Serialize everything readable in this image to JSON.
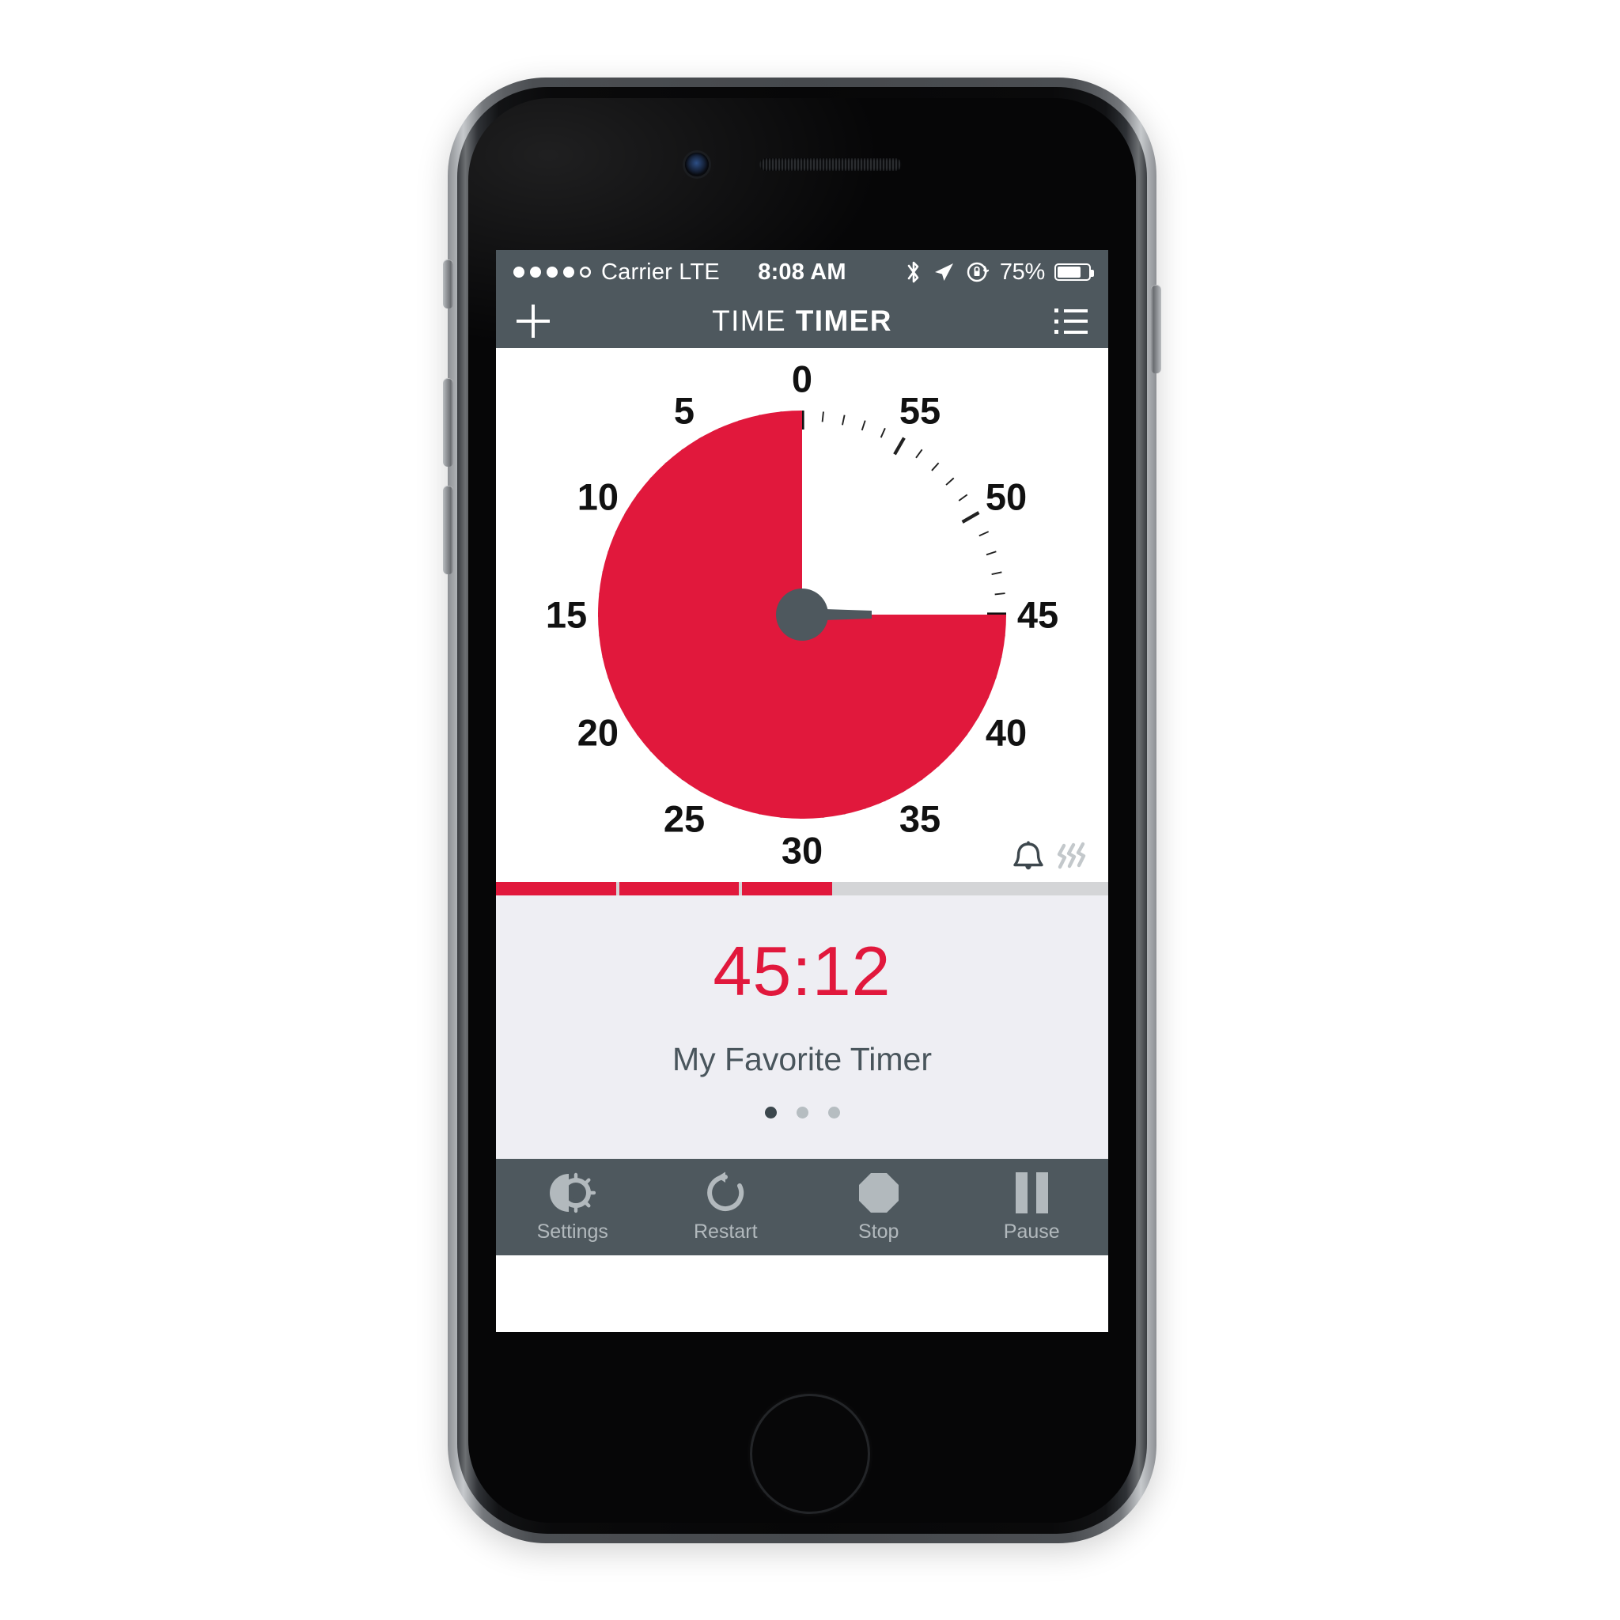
{
  "status_bar": {
    "signal_dots_filled": 4,
    "signal_dots_total": 5,
    "carrier": "Carrier LTE",
    "time": "8:08 AM",
    "bluetooth_icon": "bluetooth-icon",
    "location_icon": "location-arrow-icon",
    "rotation_lock_icon": "rotation-lock-icon",
    "battery_percent": "75%",
    "battery_level": 75
  },
  "nav_bar": {
    "add_icon": "plus-icon",
    "title_light": "TIME",
    "title_bold": "TIMER",
    "menu_icon": "list-menu-icon"
  },
  "dial": {
    "labels": [
      "0",
      "5",
      "10",
      "15",
      "20",
      "25",
      "30",
      "35",
      "40",
      "45",
      "50",
      "55"
    ],
    "remaining_minutes": 45,
    "total_minutes": 60,
    "red_color": "#e1183c",
    "hub_color": "#4e585e",
    "tick_color": "#111111"
  },
  "alerts": {
    "bell_icon": "bell-icon",
    "bell_active": true,
    "vibrate_icon": "vibrate-icon",
    "vibrate_active": false
  },
  "progress": {
    "segments": [
      100,
      100,
      75,
      0,
      0
    ],
    "fill_color": "#e1183c",
    "track_color": "#d4d5d7"
  },
  "info": {
    "time_remaining": "45:12",
    "timer_name": "My Favorite Timer",
    "page_dots": 3,
    "active_dot": 0
  },
  "toolbar": {
    "items": [
      {
        "label": "Settings",
        "icon": "settings-gear-pie-icon"
      },
      {
        "label": "Restart",
        "icon": "restart-circular-arrow-icon"
      },
      {
        "label": "Stop",
        "icon": "stop-octagon-icon"
      },
      {
        "label": "Pause",
        "icon": "pause-bars-icon"
      }
    ]
  },
  "device": {
    "camera_icon": "front-camera",
    "speaker_icon": "earpiece-speaker",
    "home_button": "home-button",
    "mute_switch": "mute-switch",
    "volume_up": "volume-up-button",
    "volume_down": "volume-down-button",
    "power_button": "power-button"
  }
}
